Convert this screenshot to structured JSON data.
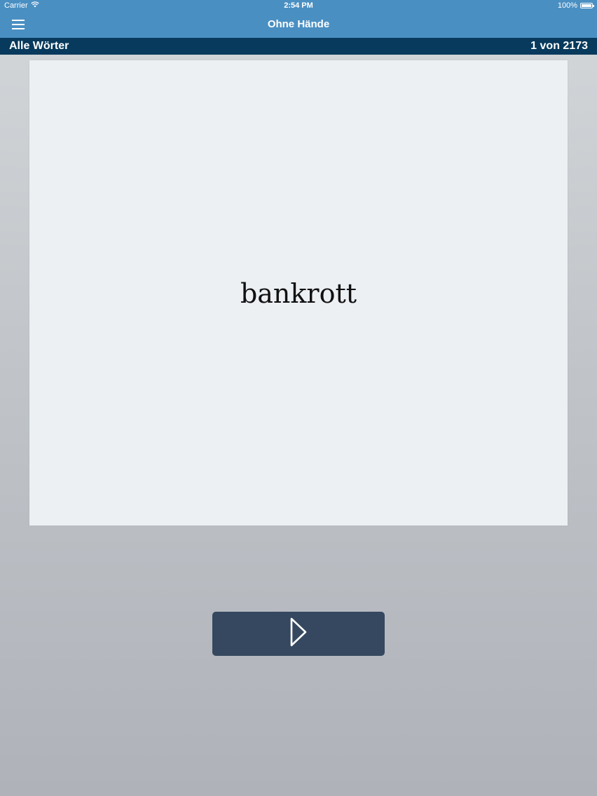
{
  "status_bar": {
    "carrier": "Carrier",
    "time": "2:54 PM",
    "battery": "100%",
    "battery_level": 1.0
  },
  "nav": {
    "title": "Ohne Hände",
    "menu_icon": "hamburger-menu-icon"
  },
  "info_bar": {
    "list_name": "Alle Wörter",
    "counter": "1 von 2173"
  },
  "card": {
    "word": "bankrott"
  },
  "controls": {
    "play_icon": "play-icon"
  },
  "colors": {
    "nav_blue": "#4a8fc2",
    "info_bar": "#073a5c",
    "card_bg": "#ecf0f3",
    "play_button": "#354860"
  }
}
